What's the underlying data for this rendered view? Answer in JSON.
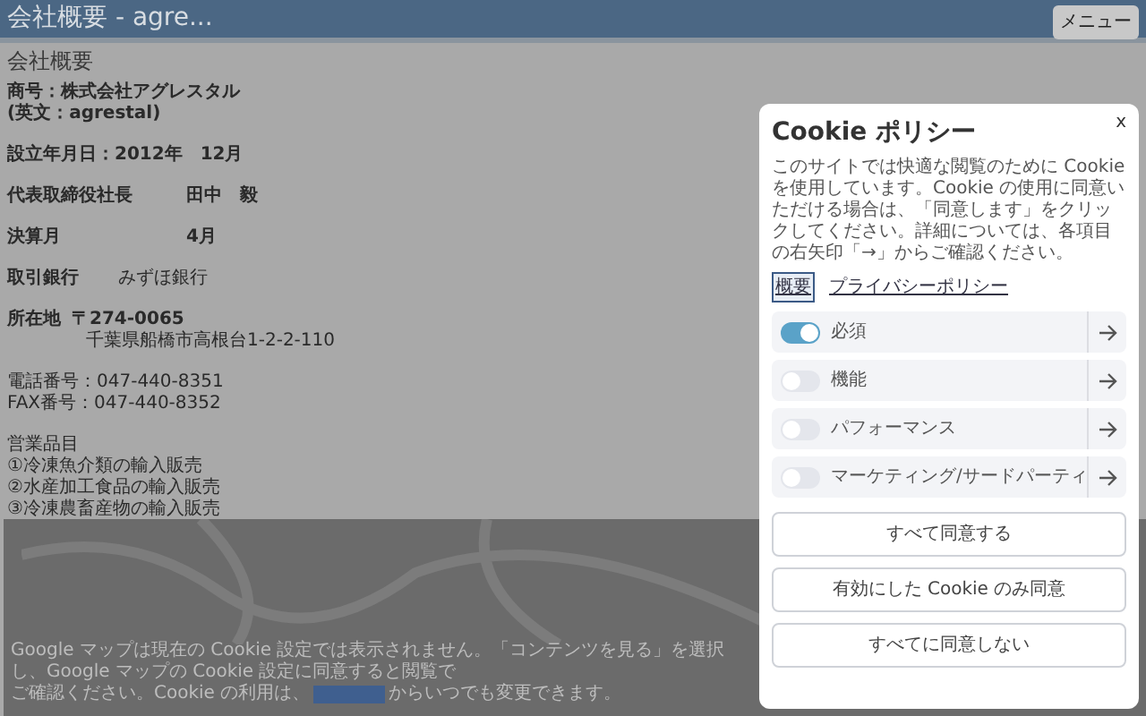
{
  "header": {
    "title": "会社概要 - agre...",
    "menu_button": "メニュー"
  },
  "page": {
    "heading": "会社概要",
    "blocks": [
      {
        "kind": "bold",
        "lines": [
          "商号：株式会社アグレスタル",
          "(英文：agrestal)"
        ]
      },
      {
        "kind": "bold",
        "lines": [
          "設立年月日：2012年　12月"
        ]
      },
      {
        "kind": "pair",
        "label": "代表取締役社長",
        "value": "田中　毅"
      },
      {
        "kind": "pair",
        "label": "決算月",
        "value": "4月"
      },
      {
        "kind": "pair_plain",
        "label": "取引銀行",
        "value": "みずほ銀行"
      },
      {
        "kind": "address",
        "label": "所在地",
        "value": "〒274-0065",
        "extra": "千葉県船橋市高根台1-2-2-110"
      },
      {
        "kind": "plain",
        "lines": [
          "電話番号：047-440-8351",
          "FAX番号：047-440-8352"
        ]
      },
      {
        "kind": "plain",
        "lines": [
          "営業品目",
          "①冷凍魚介類の輸入販売",
          "②水産加工食品の輸入販売",
          "③冷凍農畜産物の輸入販売"
        ]
      }
    ]
  },
  "map_notice": {
    "before_link": "Google マップは現在の Cookie 設定では表示されません。「コンテンツを見る」を選択し、Google マップの Cookie 設定に同意すると閲覧で",
    "line2": "ご確認ください。Cookie の利用は、",
    "after_link": "からいつでも変更できます。"
  },
  "cookie_dialog": {
    "title": "Cookie ポリシー",
    "close": "x",
    "description": "このサイトでは快適な閲覧のために Cookie を使用しています。Cookie の使用に同意いただける場合は、「同意します」をクリックしてください。詳細については、各項目の右矢印「→」からご確認ください。",
    "links": [
      {
        "label": "概要",
        "selected": true
      },
      {
        "label": "プライバシーポリシー",
        "selected": false
      }
    ],
    "categories": [
      {
        "label": "必須",
        "on": true
      },
      {
        "label": "機能",
        "on": false
      },
      {
        "label": "パフォーマンス",
        "on": false
      },
      {
        "label": "マーケティング/サードパーティ",
        "on": false
      }
    ],
    "buttons": [
      "すべて同意する",
      "有効にした Cookie のみ同意",
      "すべてに同意しない"
    ]
  }
}
